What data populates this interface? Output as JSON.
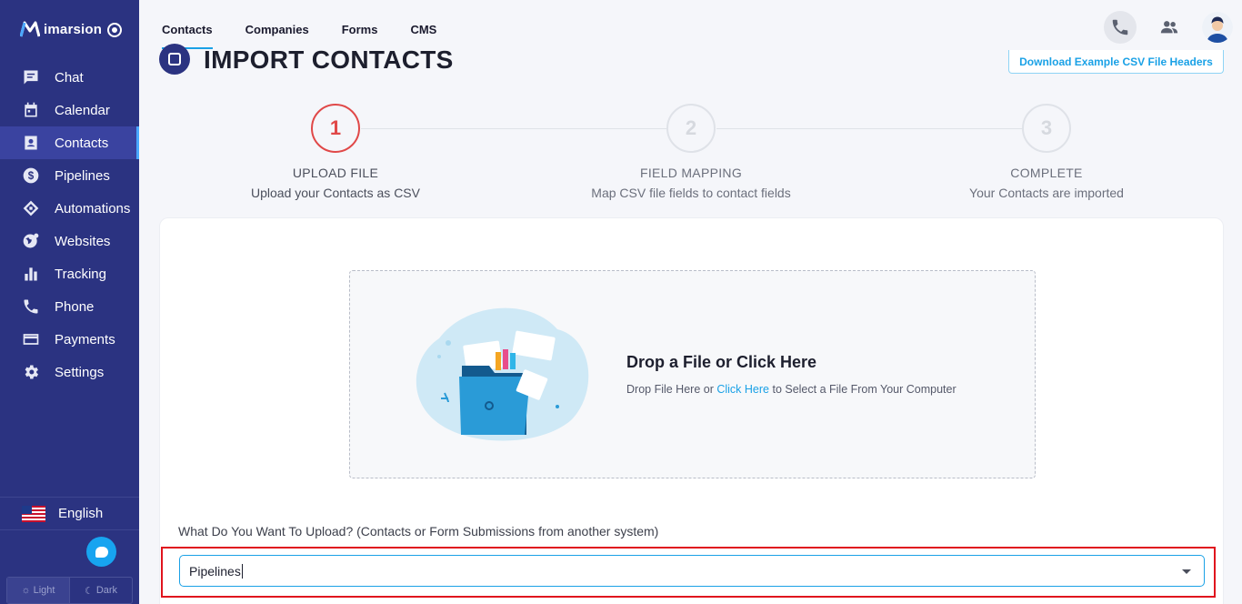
{
  "brand": {
    "name": "imarsion"
  },
  "sidebar": {
    "items": [
      {
        "label": "Chat",
        "icon": "chat-icon"
      },
      {
        "label": "Calendar",
        "icon": "calendar-icon"
      },
      {
        "label": "Contacts",
        "icon": "contacts-icon",
        "active": true
      },
      {
        "label": "Pipelines",
        "icon": "dollar-icon"
      },
      {
        "label": "Automations",
        "icon": "automation-icon"
      },
      {
        "label": "Websites",
        "icon": "globe-icon"
      },
      {
        "label": "Tracking",
        "icon": "bar-chart-icon"
      },
      {
        "label": "Phone",
        "icon": "phone-icon"
      },
      {
        "label": "Payments",
        "icon": "credit-card-icon"
      },
      {
        "label": "Settings",
        "icon": "gear-icon"
      }
    ],
    "language": "English",
    "theme": {
      "light": "Light",
      "dark": "Dark"
    }
  },
  "topbar": {
    "tabs": [
      {
        "label": "Contacts",
        "active": true
      },
      {
        "label": "Companies"
      },
      {
        "label": "Forms"
      },
      {
        "label": "CMS"
      }
    ]
  },
  "page": {
    "title": "IMPORT CONTACTS",
    "download_button": "Download Example CSV File Headers"
  },
  "steps": [
    {
      "number": "1",
      "title": "UPLOAD FILE",
      "subtitle": "Upload your Contacts as CSV",
      "state": "active"
    },
    {
      "number": "2",
      "title": "FIELD MAPPING",
      "subtitle": "Map CSV file fields to contact fields",
      "state": "inactive"
    },
    {
      "number": "3",
      "title": "COMPLETE",
      "subtitle": "Your Contacts are imported",
      "state": "inactive"
    }
  ],
  "dropzone": {
    "title": "Drop a File or Click Here",
    "desc_before": "Drop File Here or ",
    "desc_link": "Click Here",
    "desc_after": " to Select a File From Your Computer"
  },
  "upload_type": {
    "label": "What Do You Want To Upload? (Contacts or Form Submissions from another system)",
    "value": "Pipelines"
  },
  "colors": {
    "sidebar": "#2b3381",
    "accent": "#1aa1e6",
    "active_step": "#e04848",
    "highlight": "#e0141e"
  }
}
